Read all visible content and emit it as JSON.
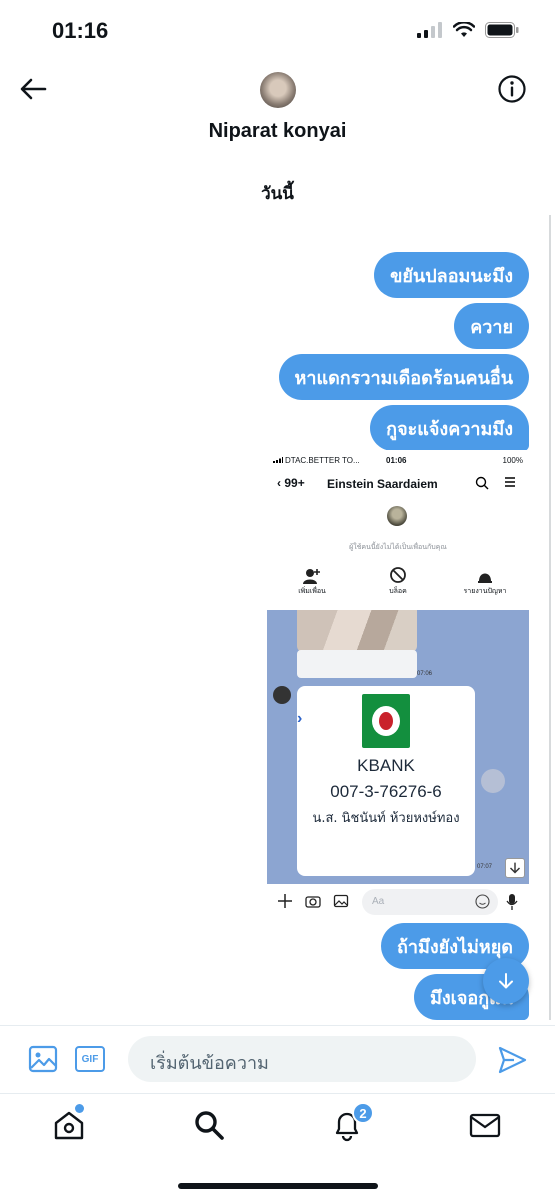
{
  "status_bar": {
    "time": "01:16"
  },
  "header": {
    "contact_name": "Niparat konyai"
  },
  "conversation": {
    "date_label": "วันนี้",
    "messages_before": [
      {
        "text": "ขยันปลอมนะมึง"
      },
      {
        "text": "ควาย"
      },
      {
        "text": "หาแดกรวามเดือดร้อนคนอื่น"
      },
      {
        "text": "กูจะแจ้งความมึง"
      }
    ],
    "messages_after": [
      {
        "text": "ถ้ามึงยังไม่หยุด"
      },
      {
        "text": "มึงเจอกูแน่"
      }
    ]
  },
  "embedded_screenshot": {
    "status": {
      "carrier": "DTAC.BETTER TO...",
      "time": "01:06",
      "battery": "100%"
    },
    "nav": {
      "back_count": "99+",
      "name": "Einstein Saardaiem"
    },
    "notice": "ผู้ใช้คนนี้ยังไม่ได้เป็นเพื่อนกับคุณ",
    "actions": [
      {
        "label": "เพิ่มเพื่อน",
        "icon": "add-friend-icon"
      },
      {
        "label": "บล็อค",
        "icon": "block-icon"
      },
      {
        "label": "รายงานปัญหา",
        "icon": "report-icon"
      }
    ],
    "time_1": "07:06",
    "card": {
      "bank": "KBANK",
      "account": "007-3-76276-6",
      "holder": "น.ส. นิชนันท์ ห้วยหงษ์ทอง"
    },
    "time_2": "07:07",
    "input_placeholder": "Aa"
  },
  "composer": {
    "gif_label": "GIF",
    "placeholder": "เริ่มต้นข้อความ"
  },
  "tabbar": {
    "notification_count": "2"
  },
  "colors": {
    "accent": "#4c9be8",
    "kbank_green": "#138f3e",
    "line_chat_bg": "#8ca5d1"
  }
}
